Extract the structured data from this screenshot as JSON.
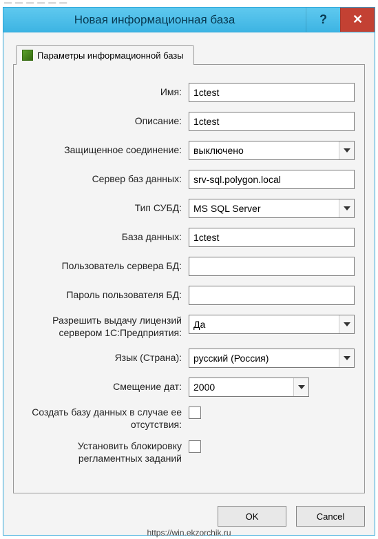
{
  "window": {
    "title": "Новая информационная база",
    "help_label": "?",
    "close_label": "✕"
  },
  "tab": {
    "label": "Параметры информационной базы"
  },
  "fields": {
    "name": {
      "label": "Имя:",
      "value": "1ctest"
    },
    "description": {
      "label": "Описание:",
      "value": "1ctest"
    },
    "secure": {
      "label": "Защищенное соединение:",
      "value": "выключено"
    },
    "dbserver": {
      "label": "Сервер баз данных:",
      "value": "srv-sql.polygon.local"
    },
    "dbtype": {
      "label": "Тип СУБД:",
      "value": "MS SQL Server"
    },
    "database": {
      "label": "База данных:",
      "value": "1ctest"
    },
    "dbuser": {
      "label": "Пользователь сервера БД:",
      "value": ""
    },
    "dbpass": {
      "label": "Пароль пользователя БД:",
      "value": ""
    },
    "license": {
      "label": "Разрешить выдачу лицензий сервером 1С:Предприятия:",
      "value": "Да"
    },
    "language": {
      "label": "Язык (Страна):",
      "value": "русский (Россия)"
    },
    "dateoffset": {
      "label": "Смещение дат:",
      "value": "2000"
    },
    "createdb": {
      "label": "Создать базу данных в случае ее отсутствия:",
      "checked": false
    },
    "blockjobs": {
      "label": "Установить блокировку регламентных заданий",
      "checked": false
    }
  },
  "buttons": {
    "ok": "OK",
    "cancel": "Cancel"
  },
  "footer": {
    "url": "https://win.ekzorchik.ru"
  }
}
